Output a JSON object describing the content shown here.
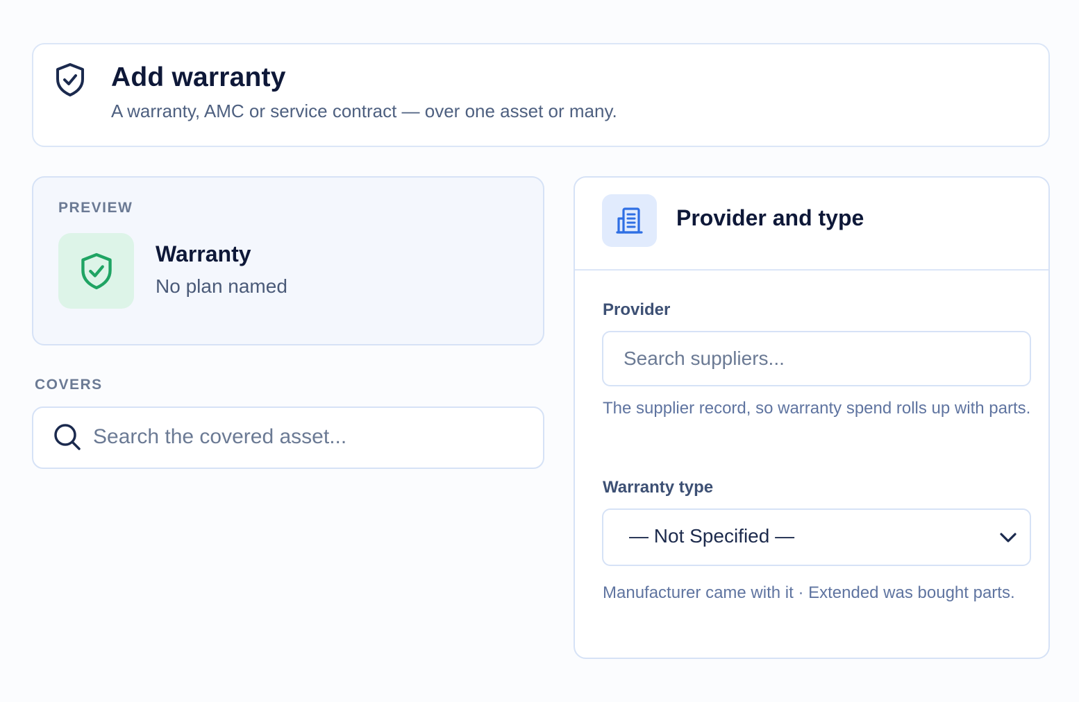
{
  "header": {
    "title": "Add warranty",
    "subtitle": "A warranty, AMC or service contract — over one asset or many.",
    "icon": "shield-check-icon"
  },
  "preview": {
    "section_label": "PREVIEW",
    "title": "Warranty",
    "subtitle": "No plan named",
    "icon": "shield-check-icon",
    "accent_color": "#1fa463"
  },
  "covers": {
    "section_label": "COVERS",
    "search_placeholder": "Search the covered asset...",
    "search_value": ""
  },
  "provider_panel": {
    "title": "Provider and type",
    "icon": "building-icon",
    "accent_color": "#2f6fe4",
    "provider": {
      "label": "Provider",
      "placeholder": "Search suppliers...",
      "value": "",
      "hint": "The supplier record, so warranty spend rolls up with parts."
    },
    "warranty_type": {
      "label": "Warranty type",
      "selected": "— Not Specified —",
      "hint": "Manufacturer came with it · Extended was bought parts."
    }
  }
}
